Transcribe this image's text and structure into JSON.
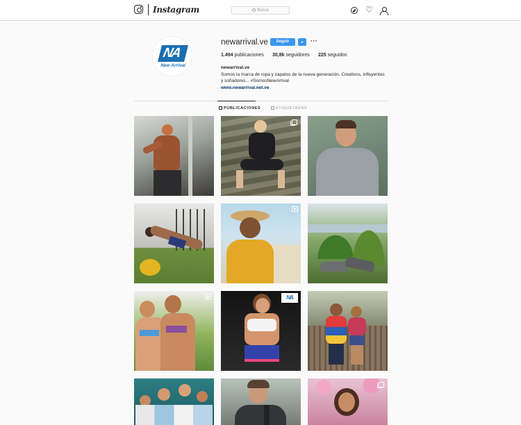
{
  "nav": {
    "wordmark": "Instagram",
    "search_placeholder": "Busca",
    "icons": [
      "instagram-glyph-icon",
      "explore-icon",
      "heart-icon",
      "profile-icon"
    ]
  },
  "profile": {
    "username": "newarrival.ve",
    "follow_label": "Seguir",
    "more_label": "···",
    "avatar_brand": "New Arrival",
    "avatar_mark": "NA",
    "stats": {
      "posts_count": "1.494",
      "posts_label": "publicaciones",
      "followers_count": "30,8k",
      "followers_label": "seguidores",
      "following_count": "225",
      "following_label": "seguidos"
    },
    "bio": {
      "name": "newarrival.ve",
      "text": "Somos la marca de ropa y zapatos de la nueva generación. Creativos, influyentes y soñadores... #SomosNewArrival",
      "link": "www.newarrival.net.ve"
    }
  },
  "tabs": {
    "posts": "PUBLICACIONES",
    "tagged": "ETIQUETADAS"
  },
  "grid": {
    "tile_mark_text": "NA",
    "tiles": [
      {
        "subject": "shirtless man exercising in gym",
        "overlay": "none"
      },
      {
        "subject": "woman in black outfit sitting on stairs",
        "overlay": "multi"
      },
      {
        "subject": "bearded man in gray sweatshirt",
        "overlay": "none"
      },
      {
        "subject": "woman doing plank in gym",
        "overlay": "none"
      },
      {
        "subject": "man with straw hat at beach",
        "overlay": "video"
      },
      {
        "subject": "gray sneakers on plants",
        "overlay": "none"
      },
      {
        "subject": "two women in bikinis",
        "overlay": "video"
      },
      {
        "subject": "woman in sports bra and blue shorts",
        "overlay": "logo"
      },
      {
        "subject": "couple on bridge",
        "overlay": "none"
      },
      {
        "subject": "group of young women",
        "overlay": "none"
      },
      {
        "subject": "bearded man holding bottle",
        "overlay": "none"
      },
      {
        "subject": "woman with pink flowers",
        "overlay": "multi"
      }
    ]
  }
}
